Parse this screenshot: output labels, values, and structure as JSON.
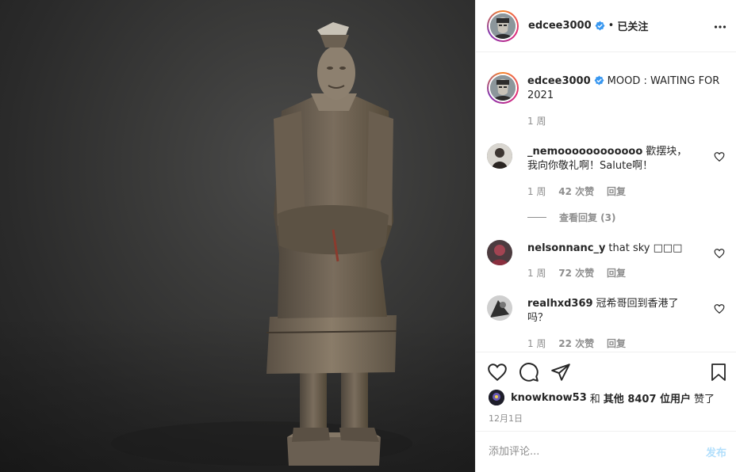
{
  "post": {
    "author": "edcee3000",
    "follow_status": "已关注",
    "dot": "•",
    "caption": "MOOD : WAITING FOR 2021",
    "caption_time": "1 周"
  },
  "comments": [
    {
      "user": "_nemoooooooooooo",
      "text": "歡摆块，我向你敬礼啊！Salute啊！",
      "time": "1 周",
      "likes": "42 次赞",
      "reply": "回复",
      "view_replies": "查看回复 (3)"
    },
    {
      "user": "nelsonnanc_y",
      "text": "that sky □□□",
      "time": "1 周",
      "likes": "72 次赞",
      "reply": "回复"
    },
    {
      "user": "realhxd369",
      "text": "冠希哥回到香港了吗？",
      "time": "1 周",
      "likes": "22 次赞",
      "reply": "回复"
    }
  ],
  "likes_line": {
    "first_user": "knowknow53",
    "and": "和",
    "others": "其他 8407 位用户",
    "suffix": "赞了"
  },
  "post_date": "12月1日",
  "add_comment": {
    "placeholder": "添加评论...",
    "post_label": "发布"
  },
  "colors": {
    "link_blue": "#0095f6",
    "disabled_blue": "#b2dffc",
    "muted": "#8e8e8e",
    "text": "#262626",
    "verified": "#3897f0"
  },
  "icons": [
    "heart-icon",
    "comment-icon",
    "share-icon",
    "bookmark-icon",
    "more-icon",
    "verified-icon"
  ]
}
